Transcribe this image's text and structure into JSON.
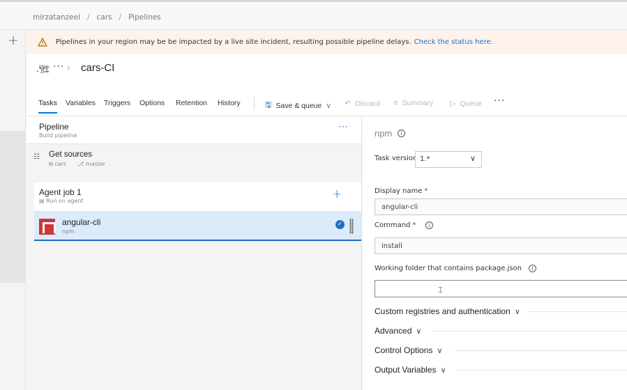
{
  "breadcrumb": [
    "mirzatanzeel",
    "cars",
    "Pipelines"
  ],
  "banner": {
    "message": "Pipelines in your region may be be impacted by a live site incident, resulting possible pipeline delays.",
    "link": "Check the status here."
  },
  "header": {
    "more": "···",
    "title": "cars-CI"
  },
  "tabs": [
    "Tasks",
    "Variables",
    "Triggers",
    "Options",
    "Retention",
    "History"
  ],
  "active_tab": "Tasks",
  "toolbar": {
    "save_queue": "Save & queue",
    "discard": "Discard",
    "summary": "Summary",
    "queue": "Queue",
    "more": "···"
  },
  "pipeline": {
    "title": "Pipeline",
    "subtitle": "Build pipeline",
    "more": "···",
    "get_sources": {
      "title": "Get sources",
      "repo": "cars",
      "branch": "master"
    },
    "agent_job": {
      "title": "Agent job 1",
      "subtitle": "Run on agent"
    },
    "task": {
      "title": "angular-cli",
      "subtitle": "npm"
    }
  },
  "detail": {
    "heading": "npm",
    "task_version_label": "Task version",
    "task_version_value": "1.*",
    "display_name_label": "Display name",
    "display_name_value": "angular-cli",
    "command_label": "Command",
    "command_value": "install",
    "working_folder_label": "Working folder that contains package.json",
    "working_folder_value": "",
    "sections": [
      "Custom registries and authentication",
      "Advanced",
      "Control Options",
      "Output Variables"
    ]
  },
  "colors": {
    "accent": "#0078d4",
    "link": "#1b6ec2",
    "npm_red": "#cb3837",
    "banner_bg": "#fdf3ec",
    "selected_bg": "#dcebf9"
  }
}
